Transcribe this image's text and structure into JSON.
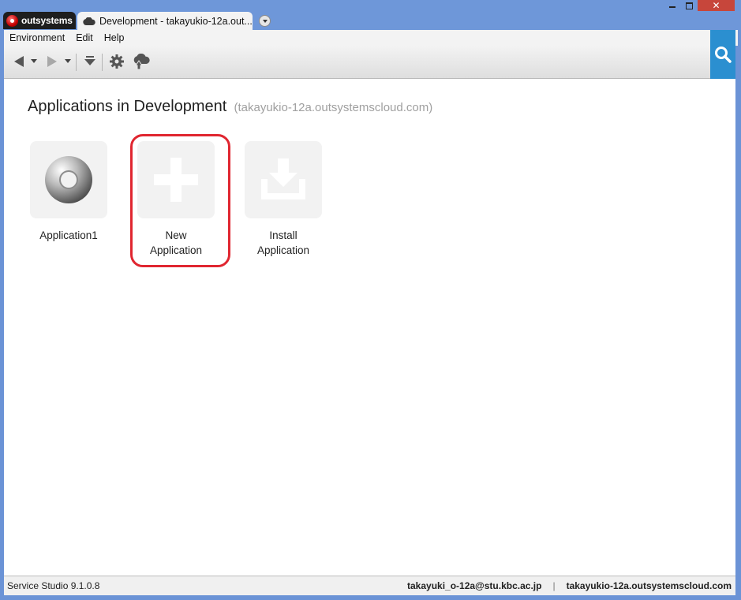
{
  "app": {
    "brand": "outsystems",
    "tab_title": "Development - takayukio-12a.out..."
  },
  "window_controls": {
    "close_glyph": "✕"
  },
  "menu": {
    "items": [
      "Environment",
      "Edit",
      "Help"
    ]
  },
  "toolbar": {
    "icons": [
      "back-arrow-icon",
      "dropdown-arrow-icon",
      "forward-arrow-icon",
      "dropdown-arrow-icon",
      "download-arrow-icon",
      "gear-icon",
      "publish-cloud-icon",
      "search-icon"
    ]
  },
  "page": {
    "title": "Applications in Development",
    "subtitle": "(takayukio-12a.outsystemscloud.com)"
  },
  "tiles": [
    {
      "label": "Application1",
      "icon": "disc-icon"
    },
    {
      "label": "New Application",
      "icon": "plus-icon",
      "highlighted": true
    },
    {
      "label": "Install Application",
      "icon": "install-download-icon"
    }
  ],
  "status": {
    "version": "Service Studio 9.1.0.8",
    "user": "takayuki_o-12a@stu.kbc.ac.jp",
    "separator": "|",
    "server": "takayukio-12a.outsystemscloud.com"
  },
  "colors": {
    "accent_blue": "#2b8fd0",
    "highlight_red": "#e02630",
    "title_bar": "#6e97d9",
    "close_red": "#c7463b"
  }
}
